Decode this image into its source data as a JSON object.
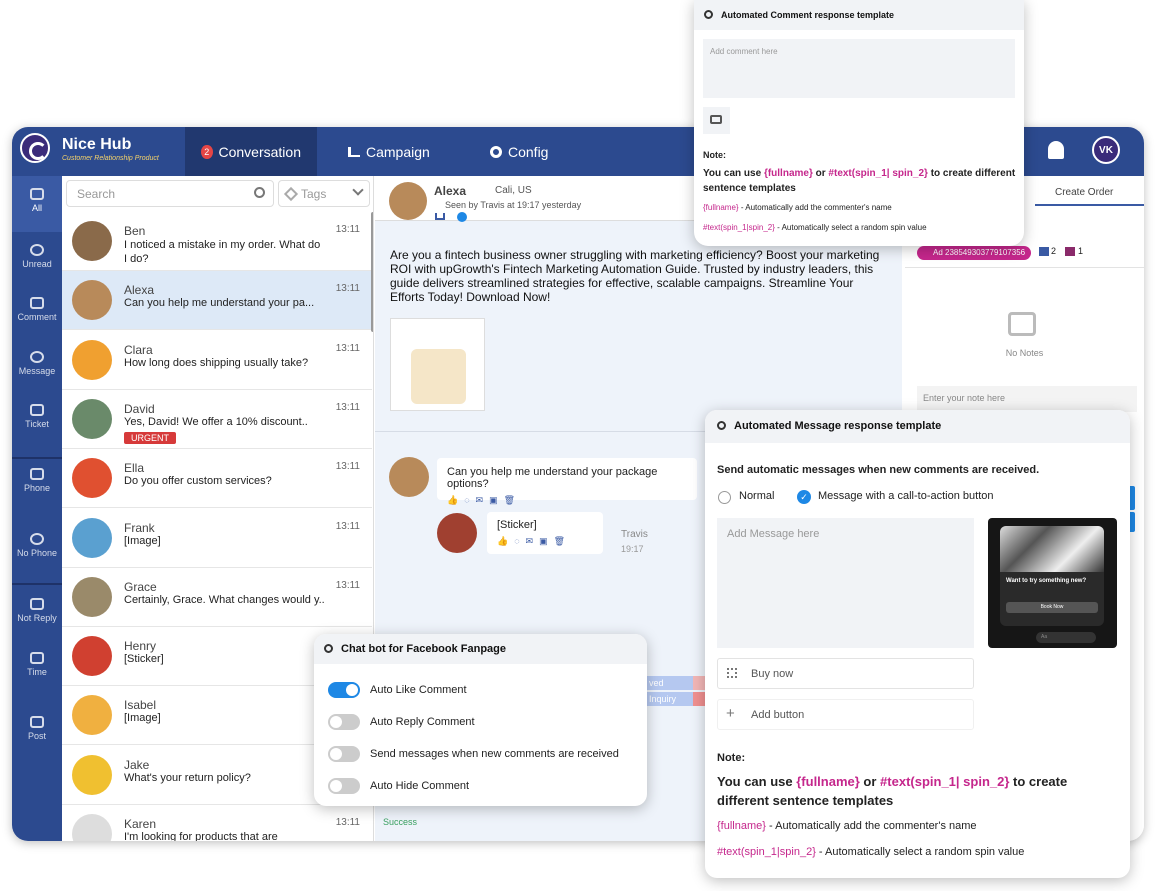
{
  "brand": {
    "name": "Nice Hub",
    "tagline": "Customer Relationship Product"
  },
  "nav": {
    "conversation": "Conversation",
    "conversation_badge": "2",
    "campaign": "Campaign",
    "config": "Config",
    "avatar": "VK"
  },
  "sidebar": [
    {
      "label": "All",
      "icon": "grid-icon"
    },
    {
      "label": "Unread",
      "icon": "eye-icon"
    },
    {
      "label": "Comment",
      "icon": "comment-icon"
    },
    {
      "label": "Message",
      "icon": "messenger-icon"
    },
    {
      "label": "Ticket",
      "icon": "ticket-icon"
    },
    {
      "label": "Phone",
      "icon": "phone-icon"
    },
    {
      "label": "No Phone",
      "icon": "no-phone-icon"
    },
    {
      "label": "Not Reply",
      "icon": "not-reply-icon"
    },
    {
      "label": "Time",
      "icon": "calendar-icon"
    },
    {
      "label": "Post",
      "icon": "post-icon"
    }
  ],
  "list": {
    "search_placeholder": "Search",
    "tags_placeholder": "Tags",
    "rows": [
      {
        "name": "Ben",
        "time": "13:11",
        "msg": "I noticed a mistake in my order. What do I do?",
        "color": "#8a6a4a"
      },
      {
        "name": "Alexa",
        "time": "13:11",
        "msg": "Can you help me understand your pa...",
        "color": "#b88a5a"
      },
      {
        "name": "Clara",
        "time": "13:11",
        "msg": "How long does shipping usually take?",
        "color": "#f0a030"
      },
      {
        "name": "David",
        "time": "13:11",
        "msg": "Yes, David! We offer a 10% discount..",
        "tag": "URGENT",
        "color": "#6a8a6a"
      },
      {
        "name": "Ella",
        "time": "13:11",
        "msg": "Do you offer custom services?",
        "color": "#e05030"
      },
      {
        "name": "Frank",
        "time": "13:11",
        "msg": "[Image]",
        "color": "#5aa0d0"
      },
      {
        "name": "Grace",
        "time": "13:11",
        "msg": "Certainly, Grace. What changes would y..",
        "color": "#9a8a6a"
      },
      {
        "name": "Henry",
        "time": "",
        "msg": "[Sticker]",
        "color": "#d04030"
      },
      {
        "name": "Isabel",
        "time": "",
        "msg": "[Image]",
        "color": "#f0b040"
      },
      {
        "name": "Jake",
        "time": "",
        "msg": "What's your return policy?",
        "color": "#f0c030"
      },
      {
        "name": "Karen",
        "time": "13:11",
        "msg": "I'm looking for products that are",
        "color": "#ddd"
      }
    ]
  },
  "chat": {
    "name": "Alexa",
    "location": "Cali, US",
    "seen": "Seen by Travis at 19:17 yesterday",
    "post": "Are you a fintech business owner struggling with marketing efficiency? Boost your marketing ROI with upGrowth's Fintech Marketing Automation Guide. Trusted by industry leaders, this guide delivers streamlined strategies for effective, scalable campaigns. Streamline Your Efforts Today! Download Now!",
    "question": "Can you help me understand your package options?",
    "sticker": "[Sticker]",
    "agent": "Travis",
    "agent_time": "19:17",
    "status": "Success",
    "tag_a": "ved",
    "tag_b": "Inquiry"
  },
  "right": {
    "create_order": "Create Order",
    "ad_id": "Ad 238549303779107356",
    "count_a": "2",
    "count_b": "1",
    "no_notes": "No Notes",
    "note_placeholder": "Enter your note here"
  },
  "comment_card": {
    "title": "Automated Comment response template",
    "placeholder": "Add comment here",
    "note_label": "Note:",
    "note_pre": "You can use ",
    "note_fullname": "{fullname}",
    "note_or": " or ",
    "note_spin": "#text(spin_1| spin_2}",
    "note_post": " to create different sentence templates",
    "line1_code": "{fullname}",
    "line1_text": " - Automatically add the commenter's name",
    "line2_code": "#text(spin_1|spin_2}",
    "line2_text": " - Automatically select a random spin value"
  },
  "bot_card": {
    "title": "Chat bot for Facebook Fanpage",
    "toggles": [
      {
        "label": "Auto Like Comment",
        "on": true
      },
      {
        "label": "Auto Reply Comment",
        "on": false
      },
      {
        "label": "Send messages when new comments are received",
        "on": false
      },
      {
        "label": "Auto Hide Comment",
        "on": false
      }
    ]
  },
  "msg_card": {
    "title": "Automated Message response template",
    "intro": "Send automatic messages when new comments are received.",
    "opt_normal": "Normal",
    "opt_cta": "Message with a call-to-action button",
    "placeholder": "Add Message here",
    "buy_now": "Buy now",
    "add_button": "Add button",
    "preview_title": "Want to try something new?",
    "preview_btn": "Book Now",
    "preview_input": "Aa",
    "note_label": "Note:",
    "note_pre": "You can use ",
    "note_fullname": "{fullname}",
    "note_or": " or ",
    "note_spin": "#text(spin_1| spin_2}",
    "note_post": " to create different sentence templates",
    "line1_code": "{fullname}",
    "line1_text": " - Automatically add the commenter's name",
    "line2_code": "#text(spin_1|spin_2}",
    "line2_text": " - Automatically select a random spin value"
  },
  "colors": {
    "primary": "#2c4a8f",
    "accent": "#1e88e5",
    "pink": "#c5278c",
    "urgent": "#d63a3a"
  }
}
